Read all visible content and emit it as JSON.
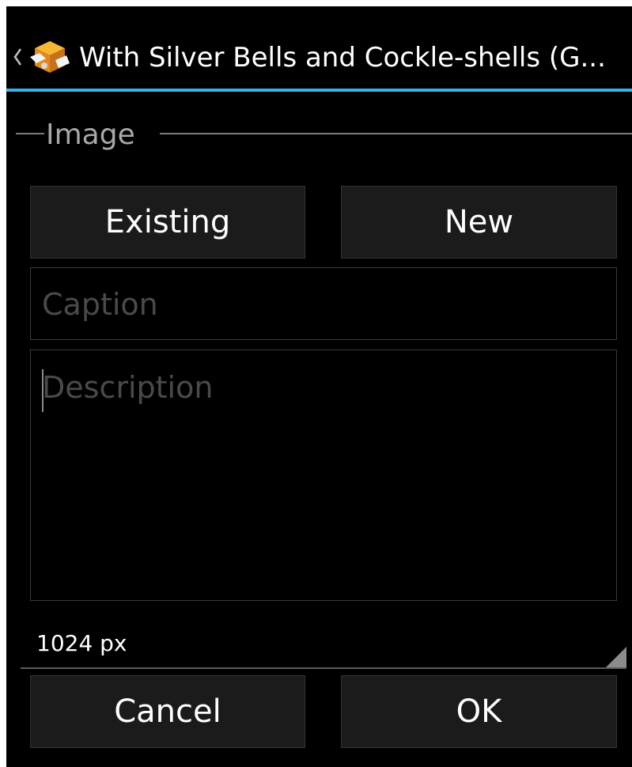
{
  "action_bar": {
    "title": "With Silver Bells and Cockle-shells (G...",
    "up_icon": "chevron-left-icon",
    "app_icon": "app-logo-icon",
    "divider_color": "#33b5e5"
  },
  "section": {
    "label": "Image"
  },
  "image_source": {
    "existing_label": "Existing",
    "new_label": "New"
  },
  "caption": {
    "placeholder": "Caption",
    "value": ""
  },
  "description": {
    "placeholder": "Description",
    "value": ""
  },
  "size": {
    "selected": "1024 px"
  },
  "dialog_buttons": {
    "cancel_label": "Cancel",
    "ok_label": "OK"
  }
}
